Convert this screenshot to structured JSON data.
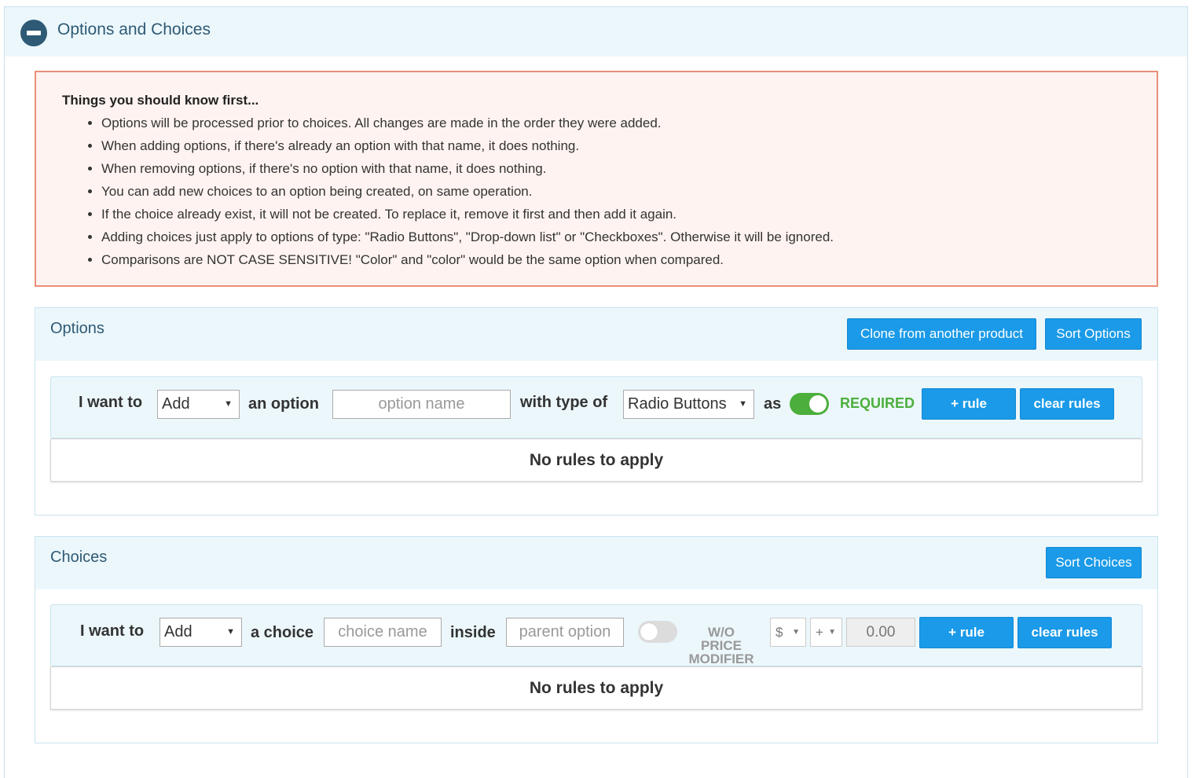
{
  "section": {
    "title": "Options and Choices"
  },
  "notice": {
    "title": "Things you should know first...",
    "items": [
      "Options will be processed prior to choices. All changes are made in the order they were added.",
      "When adding options, if there's already an option with that name, it does nothing.",
      "When removing options, if there's no option with that name, it does nothing.",
      "You can add new choices to an option being created, on same operation.",
      "If the choice already exist, it will not be created. To replace it, remove it first and then add it again.",
      "Adding choices just apply to options of type: \"Radio Buttons\", \"Drop-down list\" or \"Checkboxes\". Otherwise it will be ignored.",
      "Comparisons are NOT CASE SENSITIVE! \"Color\" and \"color\" would be the same option when compared."
    ]
  },
  "options_panel": {
    "title": "Options",
    "clone_button": "Clone from another product",
    "sort_button": "Sort Options",
    "rule": {
      "i_want_to": "I want to",
      "action_value": "Add",
      "an_option": "an option",
      "option_name_placeholder": "option name",
      "with_type_of": "with type of",
      "type_value": "Radio Buttons",
      "as": "as",
      "required_toggle_on": true,
      "required_label": "REQUIRED",
      "add_rule_button": "+ rule",
      "clear_rules_button": "clear rules"
    },
    "empty_message": "No rules to apply"
  },
  "choices_panel": {
    "title": "Choices",
    "sort_button": "Sort Choices",
    "rule": {
      "i_want_to": "I want to",
      "action_value": "Add",
      "a_choice": "a choice",
      "choice_name_placeholder": "choice name",
      "inside": "inside",
      "parent_option_placeholder": "parent option",
      "price_modifier_toggle_on": false,
      "wo_price_modifier_label": [
        "W/O",
        "PRICE",
        "MODIFIER"
      ],
      "currency_value": "$",
      "sign_value": "+",
      "price_value": "0.00",
      "add_rule_button": "+ rule",
      "clear_rules_button": "clear rules"
    },
    "empty_message": "No rules to apply"
  },
  "colors": {
    "accent_blue": "#1a9ae8",
    "header_text": "#2e5a75",
    "required_green": "#4caf3c",
    "notice_border": "#e98f78"
  }
}
